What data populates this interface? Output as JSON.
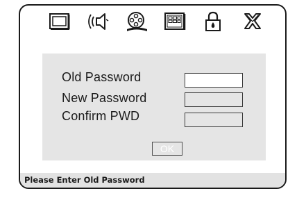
{
  "toolbar": {
    "icons": [
      {
        "name": "monitor-icon"
      },
      {
        "name": "speaker-icon"
      },
      {
        "name": "film-reel-icon"
      },
      {
        "name": "keypad-icon"
      },
      {
        "name": "lock-icon"
      },
      {
        "name": "close-icon"
      }
    ]
  },
  "form": {
    "old_password_label": "Old Password",
    "new_password_label": "New Password",
    "confirm_label": "Confirm PWD",
    "old_password_value": "",
    "new_password_value": "",
    "confirm_value": "",
    "ok_label": "OK"
  },
  "status": {
    "text": "Please Enter Old Password"
  },
  "colors": {
    "panel_bg": "#e5e5e5",
    "frame_border": "#1a1a1a",
    "status_bg": "#e2e2e2"
  }
}
